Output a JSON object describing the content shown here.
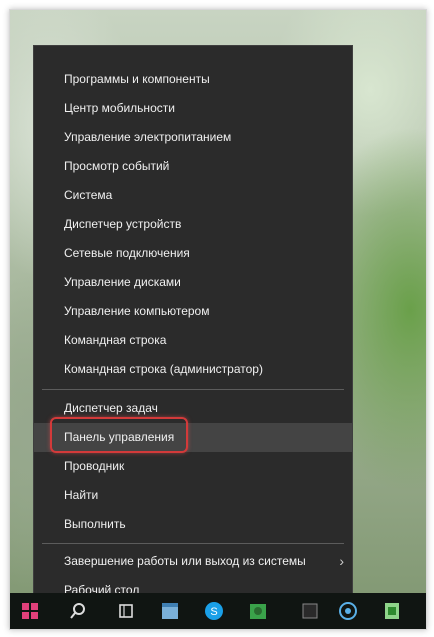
{
  "menu": {
    "group1": [
      "Программы и компоненты",
      "Центр мобильности",
      "Управление электропитанием",
      "Просмотр событий",
      "Система",
      "Диспетчер устройств",
      "Сетевые подключения",
      "Управление дисками",
      "Управление компьютером",
      "Командная строка",
      "Командная строка (администратор)"
    ],
    "group2": [
      "Диспетчер задач",
      "Панель управления",
      "Проводник",
      "Найти",
      "Выполнить"
    ],
    "group3": [
      "Завершение работы или выход из системы",
      "Рабочий стол"
    ]
  },
  "highlight_color": "#d33a3a",
  "taskbar": {
    "icons": [
      "windows-start-icon",
      "search-icon",
      "task-view-icon",
      "store-icon",
      "skype-icon",
      "game-icon",
      "browser-icon",
      "spreadsheet-icon"
    ]
  }
}
